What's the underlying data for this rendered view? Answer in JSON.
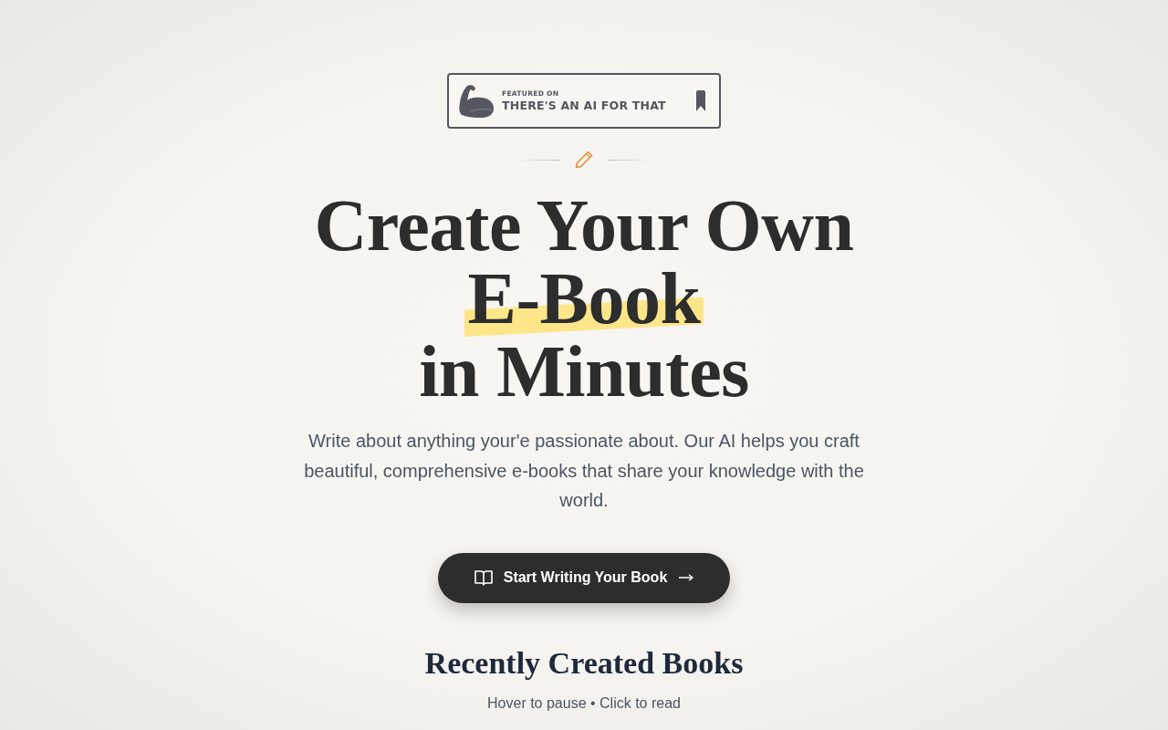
{
  "badge": {
    "kicker": "FEATURED ON",
    "name": "THERE'S AN AI FOR THAT"
  },
  "headline": [
    {
      "text": "Create Your Own",
      "highlight": false
    },
    {
      "text": "E-Book",
      "highlight": true
    },
    {
      "text": "in Minutes",
      "highlight": false
    }
  ],
  "subtitle": "Write about anything your'e passionate about. Our AI helps you craft beautiful, comprehensive e-books that share your knowledge with the world.",
  "cta_button": {
    "label": "Start Writing Your Book"
  },
  "recent_books": {
    "title": "Recently Created Books",
    "hint": "Hover to pause • Click to read"
  }
}
